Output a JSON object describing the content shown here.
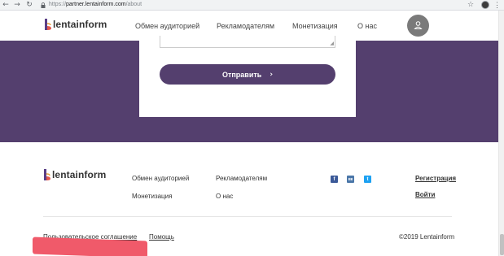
{
  "browser": {
    "back_icon": "←",
    "forward_icon": "→",
    "reload_icon": "↻",
    "url_prefix": "https://",
    "url_host": "partner.lentainform.com",
    "url_path": "/about",
    "star_icon": "☆",
    "menu_icon": "⋮"
  },
  "header": {
    "logo_text": "lentainform",
    "nav": [
      "Обмен аудиторией",
      "Рекламодателям",
      "Монетизация",
      "О нас"
    ]
  },
  "form": {
    "submit_label": "Отправить",
    "submit_arrow": "›",
    "resize_glyph": "◢"
  },
  "footer": {
    "logo_text": "lentainform",
    "links_col1": [
      "Обмен аудиторией",
      "Монетизация"
    ],
    "links_col2": [
      "Рекламодателям",
      "О нас"
    ],
    "social": [
      "facebook",
      "vk",
      "twitter"
    ],
    "social_glyphs": [
      "f",
      "вк",
      "t"
    ],
    "auth": [
      "Регистрация",
      "Войти"
    ],
    "bottom_links": [
      "Пользовательское соглашение",
      "Помощь"
    ],
    "copyright": "©2019 Lentainform"
  },
  "colors": {
    "brand_purple": "#543f6e",
    "redaction": "#f05a6a"
  }
}
